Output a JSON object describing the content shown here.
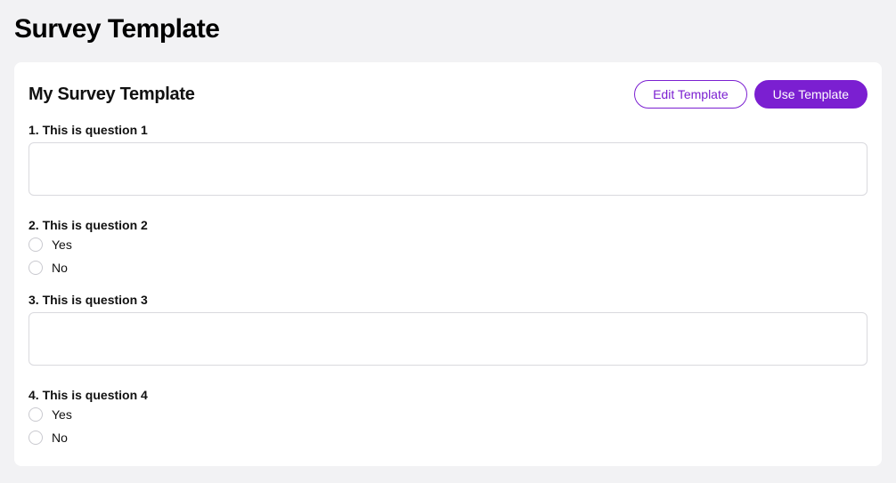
{
  "page": {
    "title": "Survey Template"
  },
  "card": {
    "title": "My Survey Template",
    "actions": {
      "edit": "Edit Template",
      "use": "Use Template"
    }
  },
  "questions": [
    {
      "label": "1. This is question 1",
      "type": "text",
      "value": ""
    },
    {
      "label": "2. This is question 2",
      "type": "radio",
      "options": [
        "Yes",
        "No"
      ]
    },
    {
      "label": "3. This is question 3",
      "type": "text",
      "value": ""
    },
    {
      "label": "4. This is question 4",
      "type": "radio",
      "options": [
        "Yes",
        "No"
      ]
    }
  ]
}
